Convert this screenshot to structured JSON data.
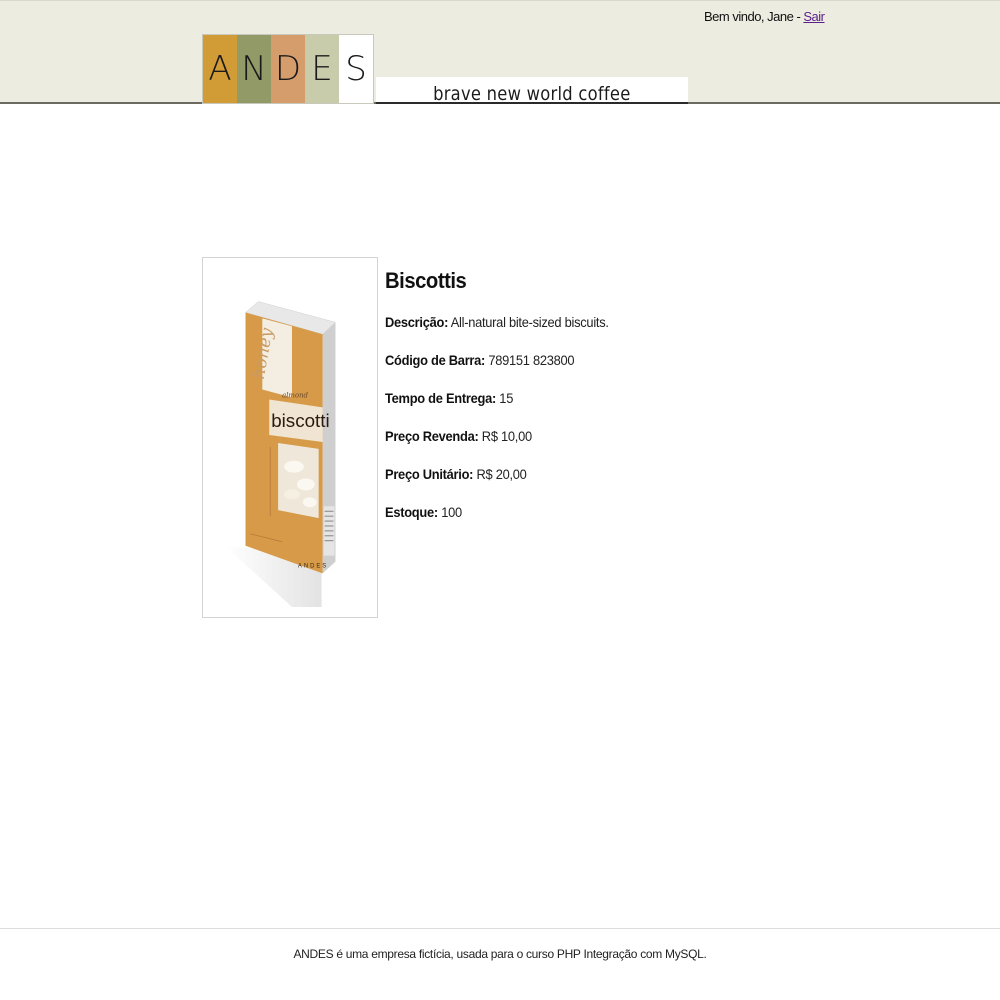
{
  "header": {
    "welcome_text": "Bem vindo, Jane - ",
    "logout_link": "Sair",
    "logo_letters": [
      "A",
      "N",
      "D",
      "E",
      "S"
    ],
    "tagline": "brave new world coffee"
  },
  "product": {
    "name": "Biscottis",
    "image_icon": "biscotti-package-image",
    "image_text": {
      "line1": "honey",
      "line2": "almond",
      "line3": "biscotti",
      "brand": "ANDES"
    },
    "fields": [
      {
        "label": "Descrição:",
        "value": "All-natural bite-sized biscuits."
      },
      {
        "label": "Código de Barra:",
        "value": "789151 823800"
      },
      {
        "label": "Tempo de Entrega:",
        "value": "15"
      },
      {
        "label": "Preço Revenda:",
        "value": "R$ 10,00"
      },
      {
        "label": "Preço Unitário:",
        "value": "R$ 20,00"
      },
      {
        "label": "Estoque:",
        "value": "100"
      }
    ]
  },
  "footer": {
    "text": "ANDES é uma empresa fictícia, usada para o curso PHP Integração com MySQL."
  },
  "colors": {
    "header_bg": "#ecece0",
    "logo_a": "#d19b35",
    "logo_n": "#929a67",
    "logo_d": "#d59c6c",
    "logo_e": "#c9ccab",
    "link": "#5a1f8a",
    "package_orange": "#d79a48"
  }
}
